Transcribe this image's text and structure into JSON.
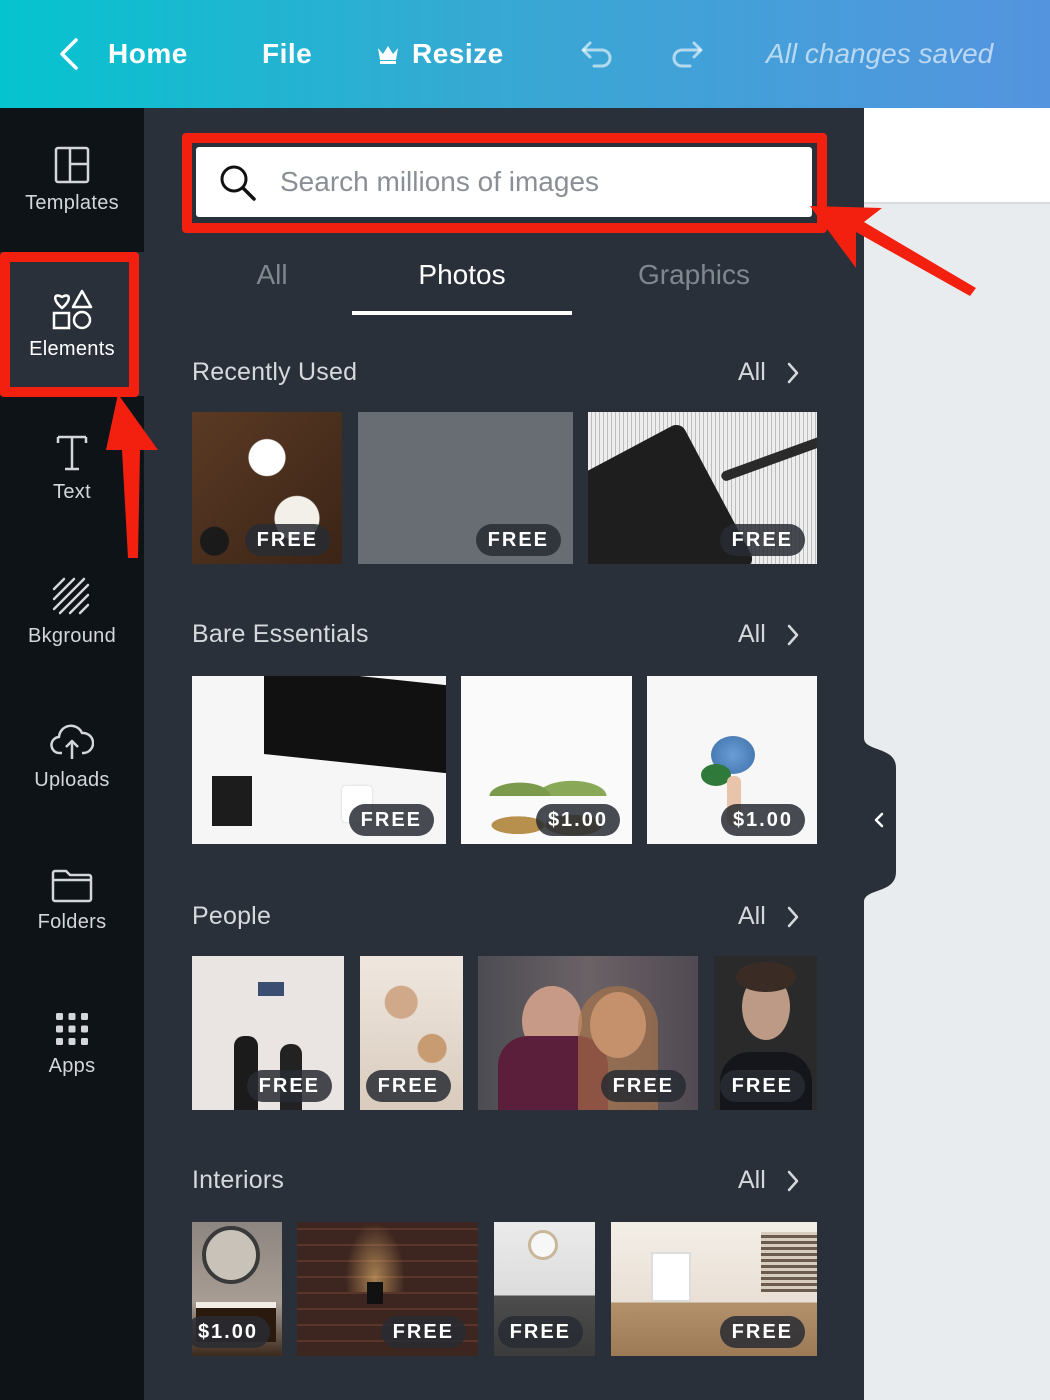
{
  "topbar": {
    "home": "Home",
    "file": "File",
    "resize": "Resize",
    "status": "All changes saved"
  },
  "nav": {
    "templates": "Templates",
    "elements": "Elements",
    "text": "Text",
    "background": "Bkground",
    "uploads": "Uploads",
    "folders": "Folders",
    "apps": "Apps"
  },
  "search": {
    "placeholder": "Search millions of images"
  },
  "tabs": {
    "all": "All",
    "photos": "Photos",
    "graphics": "Graphics"
  },
  "sections": [
    {
      "title": "Recently Used",
      "all": "All",
      "badges": [
        "FREE",
        "FREE",
        "FREE"
      ]
    },
    {
      "title": "Bare Essentials",
      "all": "All",
      "badges": [
        "FREE",
        "$1.00",
        "$1.00"
      ]
    },
    {
      "title": "People",
      "all": "All",
      "badges": [
        "FREE",
        "FREE",
        "FREE",
        "FREE"
      ]
    },
    {
      "title": "Interiors",
      "all": "All",
      "badges": [
        "$1.00",
        "FREE",
        "FREE",
        "FREE"
      ]
    }
  ],
  "colors": {
    "highlight": "#f4200f",
    "panel": "#293039",
    "nav": "#0e1318",
    "gradient_start": "#05c4cf",
    "gradient_end": "#5494df"
  }
}
